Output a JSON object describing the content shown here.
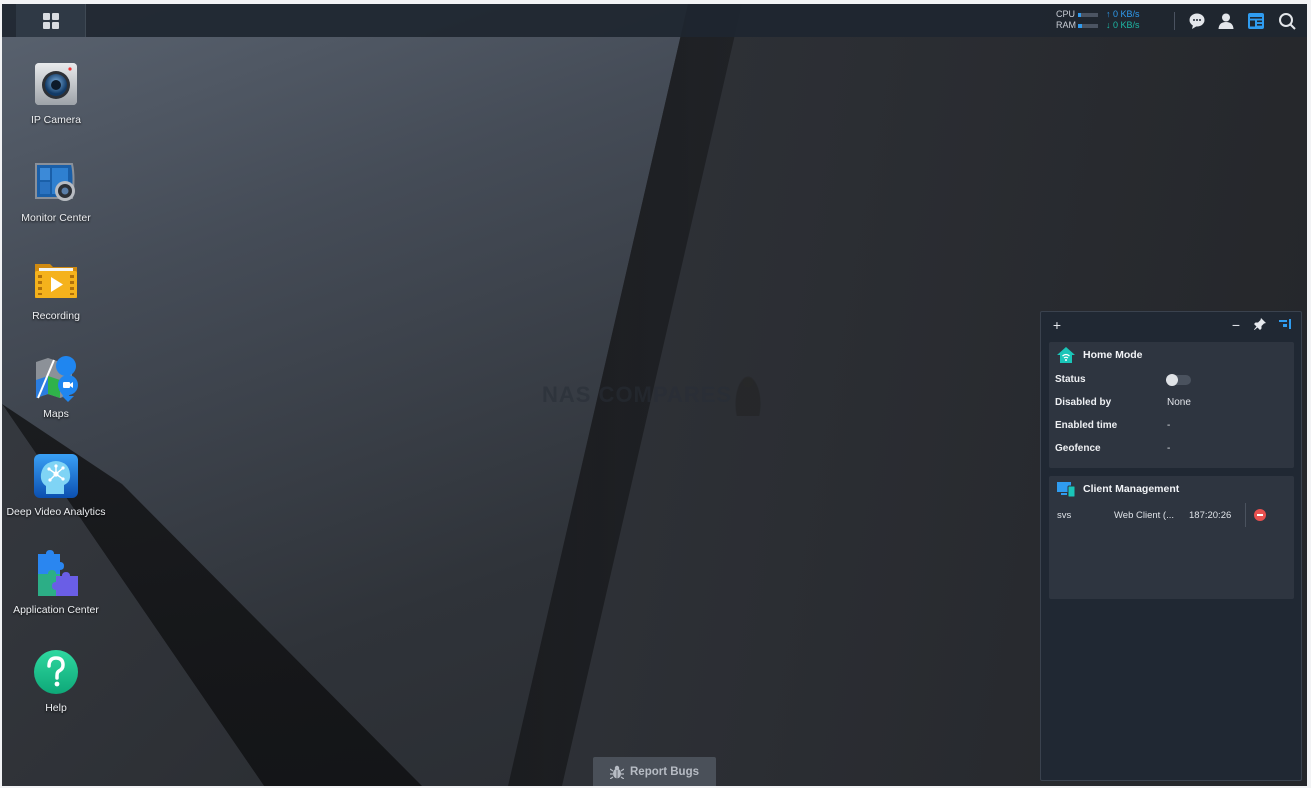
{
  "taskbar": {
    "main_menu_icon": "grid-icon",
    "system_monitor": {
      "cpu_label": "CPU",
      "ram_label": "RAM",
      "cpu_usage_fraction": 0.15,
      "ram_usage_fraction": 0.2,
      "upload": "0 KB/s",
      "download": "0 KB/s"
    },
    "icons": [
      "notifications-chat-icon",
      "user-icon",
      "widgets-icon",
      "search-icon"
    ],
    "accent_color": "#2f9cf0"
  },
  "desktop_icons": [
    {
      "label": "IP Camera",
      "icon": "ip-camera-icon"
    },
    {
      "label": "Monitor Center",
      "icon": "monitor-center-icon"
    },
    {
      "label": "Recording",
      "icon": "recording-icon"
    },
    {
      "label": "Maps",
      "icon": "maps-icon"
    },
    {
      "label": "Deep Video Analytics",
      "icon": "deep-video-analytics-icon"
    },
    {
      "label": "Application Center",
      "icon": "application-center-icon"
    },
    {
      "label": "Help",
      "icon": "help-icon"
    }
  ],
  "watermark": "NAS COMPARES",
  "widget_panel": {
    "home_mode": {
      "title": "Home Mode",
      "rows": [
        {
          "key": "Status",
          "value": "off",
          "type": "toggle"
        },
        {
          "key": "Disabled by",
          "value": "None"
        },
        {
          "key": "Enabled time",
          "value": "-"
        },
        {
          "key": "Geofence",
          "value": "-"
        }
      ]
    },
    "client_management": {
      "title": "Client Management",
      "clients": [
        {
          "user": "svs",
          "client": "Web Client (...",
          "time": "187:20:26"
        }
      ]
    }
  },
  "report_bugs": {
    "label": "Report Bugs"
  }
}
